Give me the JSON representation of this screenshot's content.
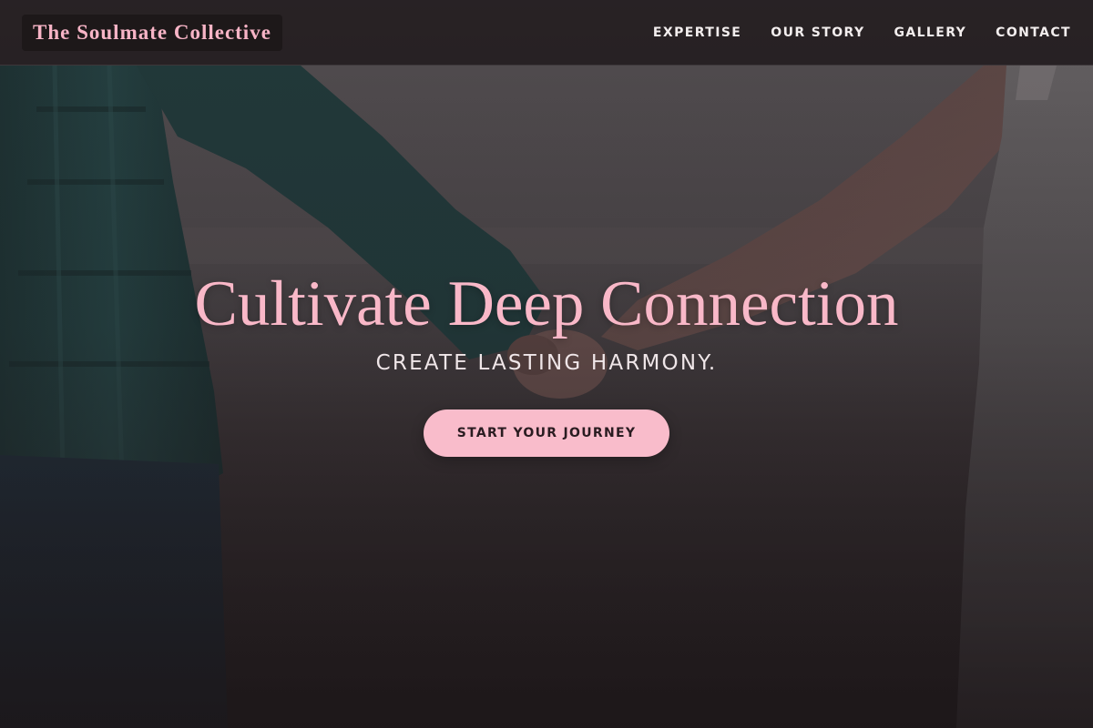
{
  "brand": {
    "name": "The Soulmate Collective"
  },
  "nav": {
    "items": [
      {
        "label": "EXPERTISE"
      },
      {
        "label": "OUR STORY"
      },
      {
        "label": "GALLERY"
      },
      {
        "label": "CONTACT"
      }
    ]
  },
  "hero": {
    "headline": "Cultivate Deep Connection",
    "subheadline": "CREATE LASTING HARMONY.",
    "cta_label": "START YOUR JOURNEY",
    "background_image": "couple-holding-hands-photo"
  },
  "colors": {
    "accent_pink": "#f9bccb",
    "headline_pink": "#f9b8c8",
    "brand_pink": "#f7b4c6",
    "header_bg": "#1c1618",
    "nav_text": "#f3eeee"
  }
}
